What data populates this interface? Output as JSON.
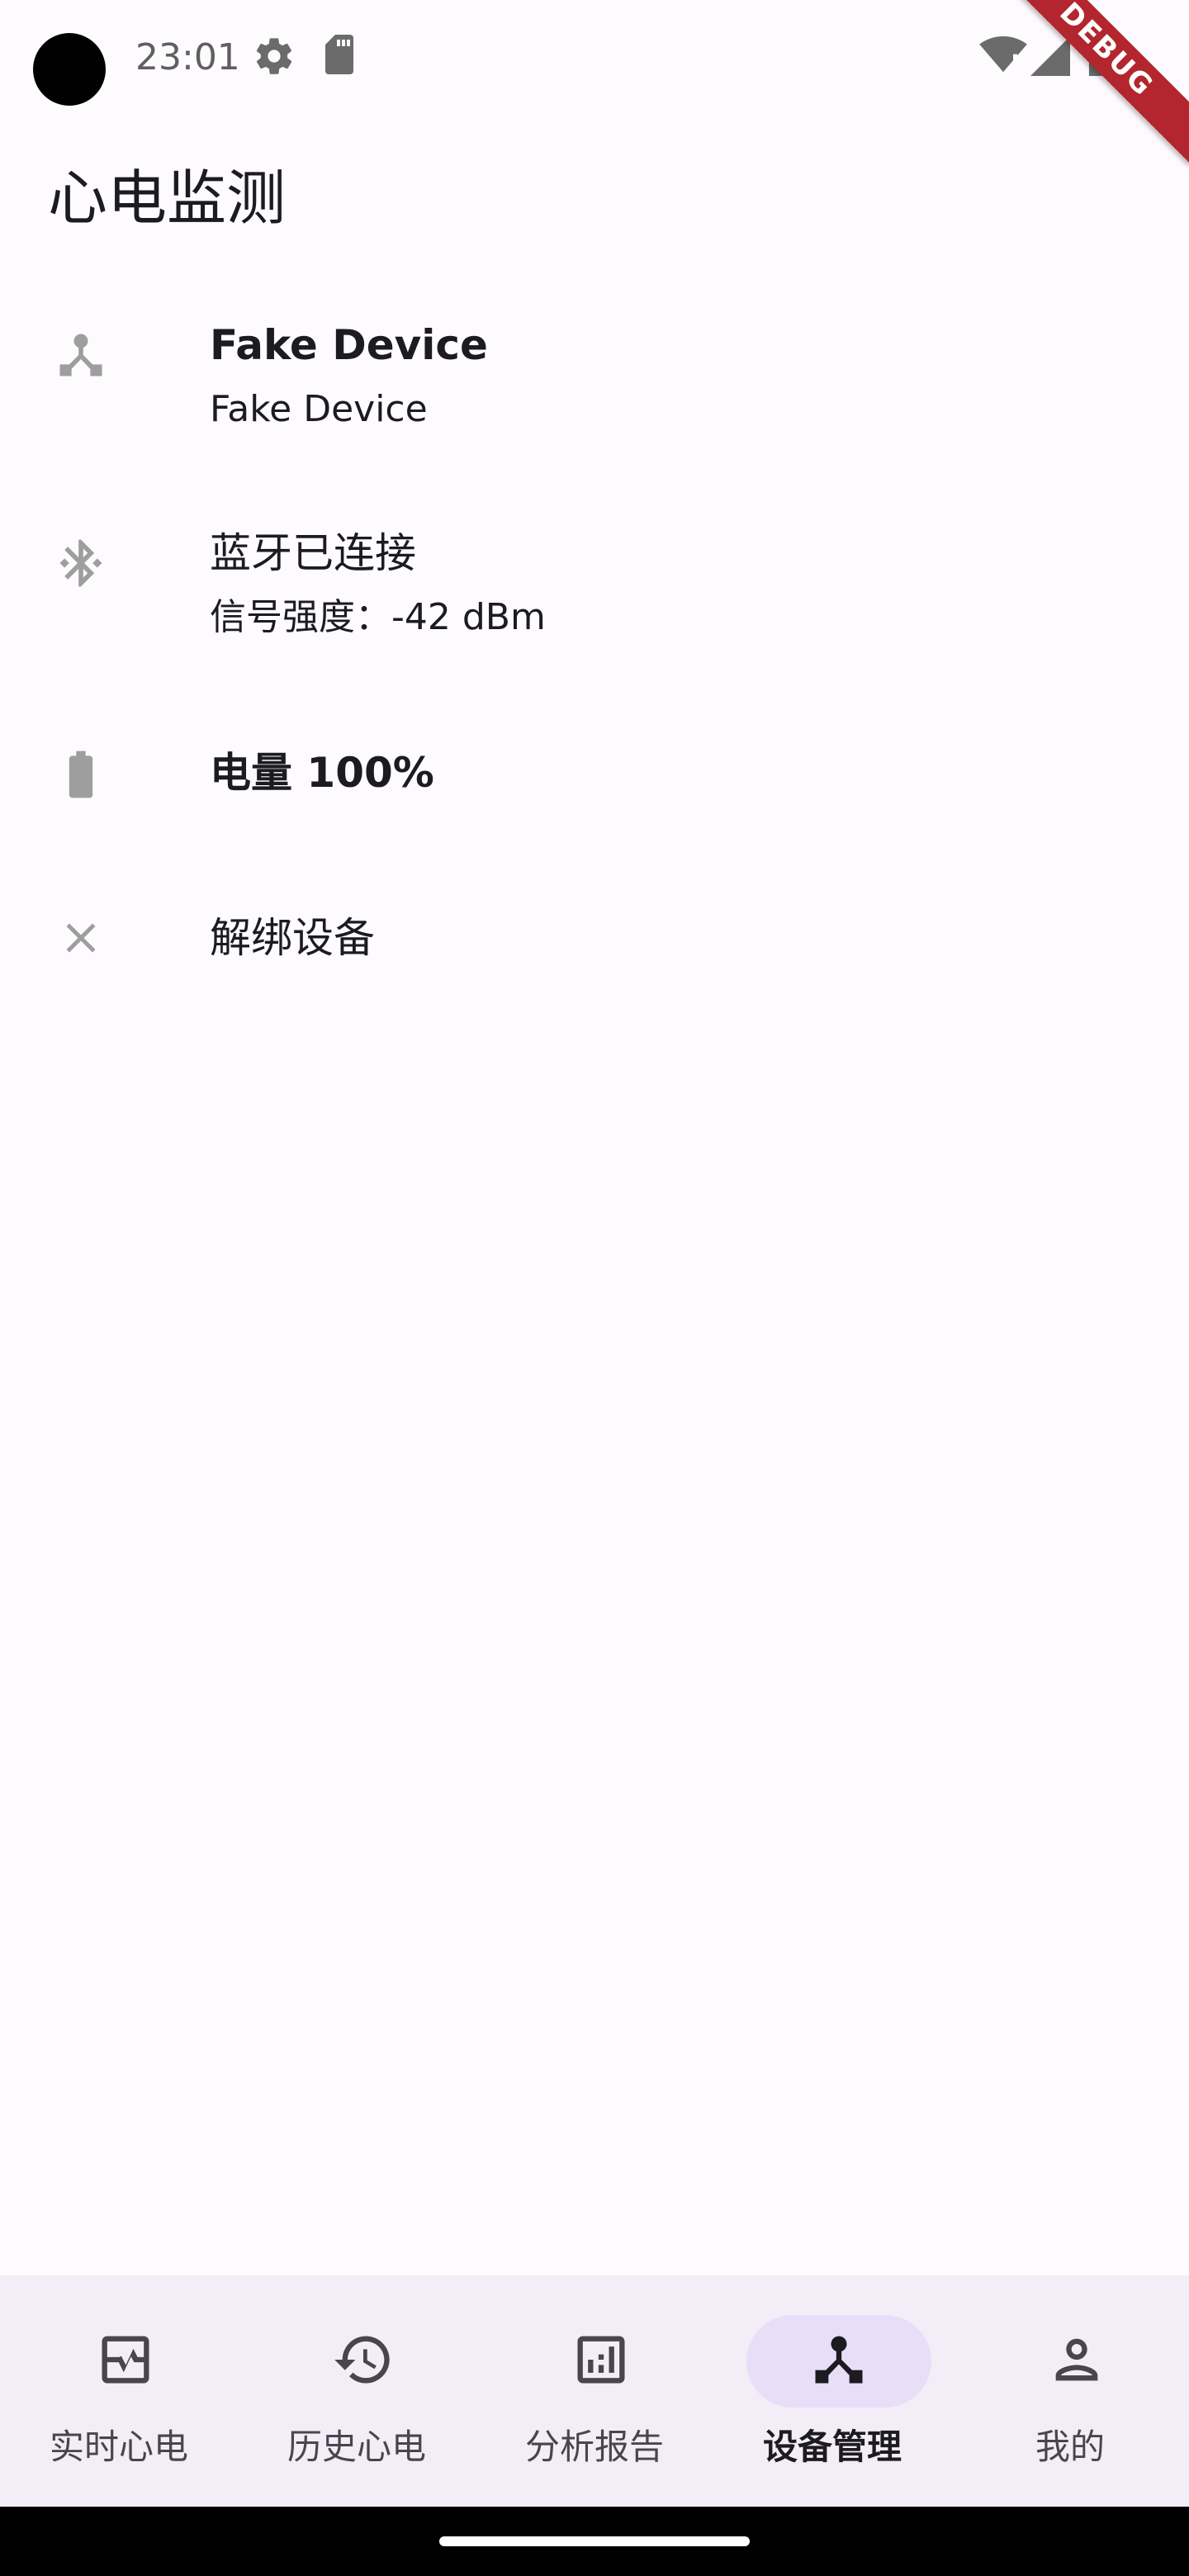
{
  "status_bar": {
    "time": "23:01",
    "icons": [
      "settings-gear-icon",
      "sd-card-icon",
      "wifi-icon",
      "cellular-signal-icon",
      "battery-icon"
    ],
    "debug_label": "DEBUG"
  },
  "app_bar": {
    "title": "心电监测"
  },
  "device_list": {
    "device": {
      "icon": "device-hub-icon",
      "title": "Fake Device",
      "subtitle": "Fake Device"
    },
    "bluetooth": {
      "icon": "bluetooth-connected-icon",
      "title": "蓝牙已连接",
      "subtitle": "信号强度：-42 dBm"
    },
    "battery": {
      "icon": "battery-full-icon",
      "title": "电量 100%"
    },
    "unbind": {
      "icon": "close-icon",
      "title": "解绑设备"
    }
  },
  "bottom_nav": {
    "items": [
      {
        "label": "实时心电",
        "icon": "ecg-monitor-icon",
        "active": false
      },
      {
        "label": "历史心电",
        "icon": "history-icon",
        "active": false
      },
      {
        "label": "分析报告",
        "icon": "analytics-icon",
        "active": false
      },
      {
        "label": "设备管理",
        "icon": "device-hub-icon",
        "active": true
      },
      {
        "label": "我的",
        "icon": "person-icon",
        "active": false
      }
    ]
  },
  "colors": {
    "background": "#fefbff",
    "nav_background": "#f3edf7",
    "nav_indicator": "#e8def8",
    "icon_gray": "#9e9e9e",
    "debug_banner": "#b3262d"
  }
}
